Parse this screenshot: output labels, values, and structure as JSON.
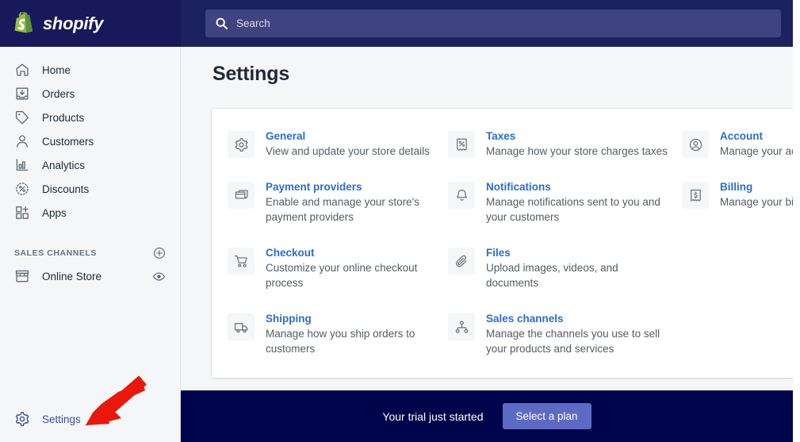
{
  "brand": {
    "name": "shopify",
    "logo_icon": "shopify-bag-icon",
    "logo_green": "#95bf46",
    "logo_green_dark": "#5e8e3e",
    "topbar_color": "#1c2260",
    "accent_color": "#2c6ecb",
    "button_color": "#5c6ac4",
    "footer_color": "#00044a"
  },
  "search": {
    "icon": "search-icon",
    "placeholder": "Search",
    "value": ""
  },
  "sidebar": {
    "items": [
      {
        "label": "Home",
        "icon": "home-icon"
      },
      {
        "label": "Orders",
        "icon": "orders-inbox-icon"
      },
      {
        "label": "Products",
        "icon": "tag-icon"
      },
      {
        "label": "Customers",
        "icon": "person-icon"
      },
      {
        "label": "Analytics",
        "icon": "bar-chart-icon"
      },
      {
        "label": "Discounts",
        "icon": "percent-badge-icon"
      },
      {
        "label": "Apps",
        "icon": "apps-grid-plus-icon"
      }
    ],
    "sales_channels": {
      "title": "SALES CHANNELS",
      "add_icon": "plus-circle-icon",
      "channels": [
        {
          "label": "Online Store",
          "icon": "storefront-icon",
          "action_icon": "eye-icon"
        }
      ]
    },
    "settings": {
      "label": "Settings",
      "icon": "gear-icon"
    }
  },
  "main": {
    "title": "Settings",
    "columns": [
      {
        "items": [
          {
            "title": "General",
            "desc": "View and update your store details",
            "icon": "gear-icon"
          },
          {
            "title": "Payment providers",
            "desc": "Enable and manage your store's payment providers",
            "icon": "credit-card-icon"
          },
          {
            "title": "Checkout",
            "desc": "Customize your online checkout process",
            "icon": "shopping-cart-icon"
          },
          {
            "title": "Shipping",
            "desc": "Manage how you ship orders to customers",
            "icon": "truck-icon"
          }
        ]
      },
      {
        "items": [
          {
            "title": "Taxes",
            "desc": "Manage how your store charges taxes",
            "icon": "tax-receipt-icon"
          },
          {
            "title": "Notifications",
            "desc": "Manage notifications sent to you and your customers",
            "icon": "bell-icon"
          },
          {
            "title": "Files",
            "desc": "Upload images, videos, and documents",
            "icon": "paperclip-icon"
          },
          {
            "title": "Sales channels",
            "desc": "Manage the channels you use to sell your products and services",
            "icon": "nodes-icon"
          }
        ]
      },
      {
        "items": [
          {
            "title": "Account",
            "desc": "Manage your account and permissions",
            "icon": "account-circle-icon"
          },
          {
            "title": "Billing",
            "desc": "Manage your billing information and view your invoices",
            "icon": "billing-receipt-icon"
          }
        ]
      }
    ]
  },
  "footer": {
    "message": "Your trial just started",
    "cta_label": "Select a plan"
  },
  "annotation": {
    "arrow_color": "#e8180c",
    "points_to": "Settings"
  }
}
